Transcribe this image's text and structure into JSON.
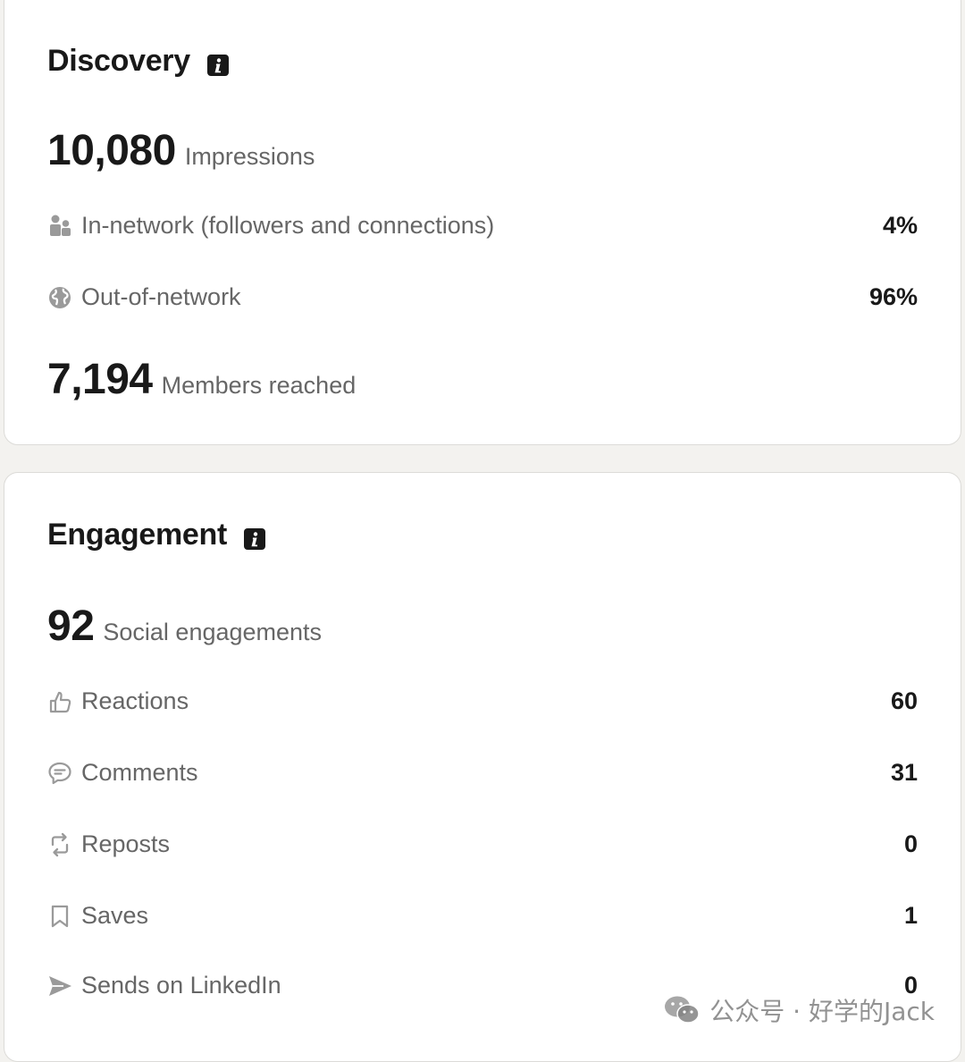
{
  "discovery": {
    "title": "Discovery",
    "impressions": {
      "value": "10,080",
      "label": "Impressions"
    },
    "rows": [
      {
        "icon": "people-icon",
        "label": "In-network (followers and connections)",
        "value": "4%"
      },
      {
        "icon": "globe-icon",
        "label": "Out-of-network",
        "value": "96%"
      }
    ],
    "members": {
      "value": "7,194",
      "label": "Members reached"
    }
  },
  "engagement": {
    "title": "Engagement",
    "social": {
      "value": "92",
      "label": "Social engagements"
    },
    "rows": [
      {
        "icon": "thumbs-up-icon",
        "label": "Reactions",
        "value": "60"
      },
      {
        "icon": "comment-icon",
        "label": "Comments",
        "value": "31"
      },
      {
        "icon": "repost-icon",
        "label": "Reposts",
        "value": "0"
      },
      {
        "icon": "bookmark-icon",
        "label": "Saves",
        "value": "1"
      },
      {
        "icon": "send-icon",
        "label": "Sends on LinkedIn",
        "value": "0"
      }
    ]
  },
  "watermark": {
    "text": "公众号 · 好学的Jack",
    "icon": "wechat-icon"
  },
  "colors": {
    "background": "#f3f2ef",
    "card": "#ffffff",
    "text": "#191919",
    "muted": "#666666"
  }
}
